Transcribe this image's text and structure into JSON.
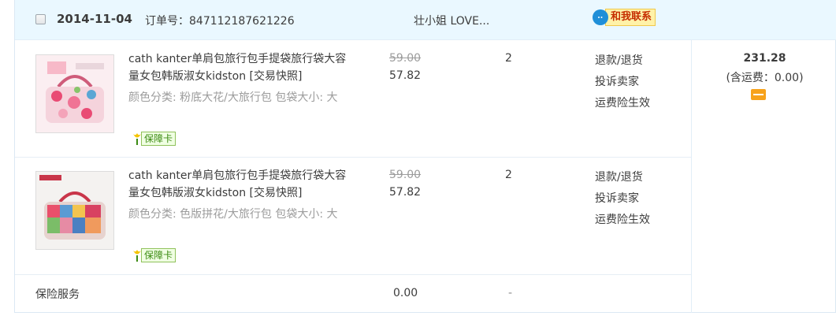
{
  "order": {
    "date": "2014-11-04",
    "order_no": "订单号：847112187621226",
    "seller": "壮小姐 LOVE...",
    "contact_label": "和我联系",
    "total": "231.28",
    "shipping": "(含运费：0.00)"
  },
  "items": [
    {
      "title": "cath kanter单肩包旅行包手提袋旅行袋大容量女包韩版淑女kidston [交易快照]",
      "sku": "颜色分类: 粉底大花/大旅行包 包袋大小: 大",
      "badge": "保障卡",
      "original_price": "59.00",
      "price": "57.82",
      "quantity": "2",
      "actions": [
        "退款/退货",
        "投诉卖家",
        "运费险生效"
      ]
    },
    {
      "title": "cath kanter单肩包旅行包手提袋旅行袋大容量女包韩版淑女kidston [交易快照]",
      "sku": "颜色分类: 色版拼花/大旅行包 包袋大小: 大",
      "badge": "保障卡",
      "original_price": "59.00",
      "price": "57.82",
      "quantity": "2",
      "actions": [
        "退款/退货",
        "投诉卖家",
        "运费险生效"
      ]
    }
  ],
  "insurance": {
    "label": "保险服务",
    "price": "0.00",
    "quantity": "-"
  },
  "icons": {
    "checkbox": "checkbox-icon",
    "contact": "chat-bubble-icon",
    "badge": "tulip-icon",
    "payment": "card-icon"
  }
}
